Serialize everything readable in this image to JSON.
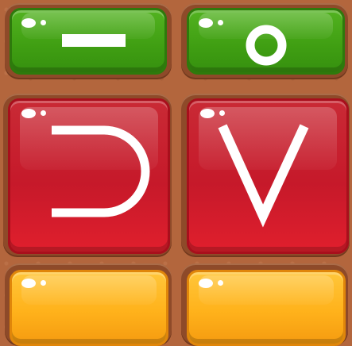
{
  "board": {
    "tiles": [
      {
        "color": "green",
        "symbol": "minus"
      },
      {
        "color": "green",
        "symbol": "circle"
      },
      {
        "color": "red",
        "symbol": "reversed-c"
      },
      {
        "color": "red",
        "symbol": "v"
      },
      {
        "color": "orange",
        "symbol": "none"
      },
      {
        "color": "orange",
        "symbol": "none"
      }
    ]
  },
  "colors": {
    "board": "#b3663d",
    "green": "#46a615",
    "red": "#cc1d2b",
    "orange": "#ffb21b",
    "symbol": "#ffffff"
  }
}
